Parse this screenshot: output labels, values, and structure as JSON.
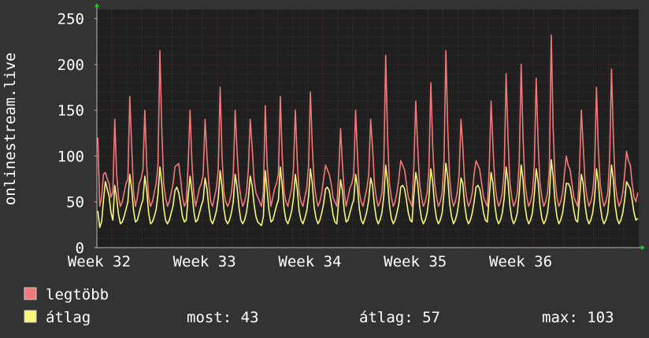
{
  "chart_data": {
    "type": "line",
    "ylabel": "onlinestream.live",
    "ylim": [
      0,
      260
    ],
    "y_ticks": [
      0,
      50,
      100,
      150,
      200,
      250
    ],
    "x_labels": [
      "Week 32",
      "Week 33",
      "Week 34",
      "Week 35",
      "Week 36"
    ],
    "grid": true,
    "legend_position": "bottom-left",
    "samples_per_day": 8,
    "series": [
      {
        "name": "legtöbb",
        "color": "#f27979",
        "values": [
          120,
          45,
          55,
          80,
          82,
          75,
          70,
          55,
          60,
          140,
          80,
          55,
          45,
          50,
          60,
          70,
          75,
          165,
          110,
          60,
          45,
          55,
          70,
          75,
          85,
          150,
          90,
          55,
          45,
          50,
          60,
          70,
          90,
          215,
          130,
          70,
          55,
          45,
          50,
          60,
          70,
          88,
          90,
          92,
          75,
          55,
          45,
          50,
          90,
          150,
          95,
          60,
          45,
          55,
          65,
          70,
          80,
          140,
          100,
          70,
          50,
          45,
          55,
          65,
          85,
          175,
          100,
          60,
          50,
          45,
          50,
          60,
          80,
          150,
          105,
          70,
          55,
          45,
          50,
          60,
          85,
          140,
          110,
          75,
          60,
          55,
          50,
          45,
          60,
          155,
          90,
          65,
          45,
          55,
          65,
          70,
          80,
          165,
          100,
          60,
          50,
          45,
          55,
          65,
          85,
          150,
          95,
          60,
          50,
          45,
          55,
          65,
          90,
          170,
          110,
          70,
          55,
          45,
          50,
          60,
          75,
          90,
          85,
          80,
          70,
          55,
          50,
          45,
          80,
          130,
          90,
          60,
          45,
          55,
          65,
          70,
          80,
          150,
          100,
          60,
          50,
          45,
          55,
          65,
          80,
          140,
          110,
          70,
          55,
          45,
          50,
          60,
          90,
          210,
          120,
          70,
          55,
          45,
          50,
          60,
          75,
          95,
          90,
          85,
          70,
          55,
          50,
          45,
          90,
          160,
          110,
          70,
          55,
          45,
          50,
          60,
          85,
          180,
          110,
          70,
          55,
          45,
          50,
          60,
          95,
          215,
          130,
          75,
          55,
          45,
          50,
          60,
          80,
          140,
          110,
          70,
          55,
          45,
          50,
          60,
          80,
          95,
          90,
          85,
          70,
          55,
          50,
          45,
          85,
          160,
          110,
          70,
          55,
          45,
          50,
          60,
          85,
          190,
          120,
          70,
          55,
          45,
          50,
          60,
          95,
          200,
          120,
          70,
          55,
          45,
          50,
          60,
          90,
          185,
          115,
          70,
          55,
          45,
          50,
          60,
          85,
          232,
          130,
          75,
          55,
          45,
          50,
          60,
          80,
          100,
          90,
          85,
          70,
          55,
          50,
          45,
          85,
          150,
          110,
          70,
          55,
          45,
          50,
          60,
          85,
          175,
          110,
          70,
          55,
          45,
          50,
          60,
          95,
          195,
          120,
          70,
          55,
          45,
          50,
          60,
          80,
          105,
          95,
          90,
          70,
          55,
          50,
          60
        ]
      },
      {
        "name": "átlag",
        "color": "#f7f77a",
        "values": [
          40,
          22,
          28,
          52,
          72,
          64,
          56,
          38,
          30,
          68,
          54,
          36,
          26,
          28,
          34,
          42,
          50,
          80,
          64,
          40,
          28,
          30,
          38,
          46,
          52,
          78,
          62,
          38,
          26,
          28,
          34,
          42,
          58,
          88,
          70,
          44,
          30,
          26,
          30,
          38,
          46,
          62,
          66,
          60,
          48,
          34,
          28,
          30,
          56,
          78,
          62,
          40,
          28,
          30,
          38,
          46,
          52,
          76,
          64,
          44,
          30,
          26,
          32,
          40,
          54,
          84,
          66,
          42,
          30,
          26,
          30,
          38,
          50,
          80,
          66,
          44,
          30,
          26,
          30,
          38,
          54,
          78,
          68,
          48,
          34,
          28,
          26,
          24,
          34,
          84,
          62,
          40,
          28,
          30,
          38,
          46,
          52,
          88,
          68,
          42,
          30,
          26,
          32,
          40,
          54,
          80,
          64,
          40,
          30,
          26,
          32,
          40,
          56,
          86,
          70,
          44,
          32,
          26,
          30,
          38,
          48,
          64,
          66,
          62,
          50,
          36,
          28,
          26,
          50,
          74,
          62,
          40,
          28,
          30,
          38,
          46,
          52,
          80,
          66,
          42,
          30,
          26,
          32,
          40,
          52,
          76,
          68,
          46,
          32,
          26,
          30,
          38,
          56,
          90,
          72,
          46,
          32,
          26,
          30,
          38,
          48,
          66,
          68,
          64,
          52,
          38,
          30,
          28,
          58,
          82,
          70,
          46,
          32,
          26,
          30,
          38,
          54,
          86,
          72,
          46,
          32,
          26,
          30,
          38,
          60,
          92,
          76,
          48,
          34,
          26,
          30,
          38,
          52,
          76,
          70,
          46,
          32,
          26,
          30,
          38,
          50,
          66,
          68,
          64,
          52,
          38,
          30,
          28,
          54,
          82,
          70,
          46,
          32,
          26,
          30,
          38,
          54,
          88,
          72,
          46,
          32,
          26,
          30,
          38,
          60,
          90,
          74,
          46,
          32,
          26,
          30,
          38,
          58,
          86,
          72,
          46,
          32,
          26,
          30,
          38,
          56,
          96,
          78,
          50,
          34,
          26,
          30,
          38,
          52,
          70,
          70,
          66,
          54,
          40,
          30,
          28,
          54,
          80,
          70,
          46,
          32,
          26,
          30,
          38,
          54,
          86,
          72,
          46,
          32,
          26,
          30,
          38,
          60,
          90,
          74,
          46,
          32,
          26,
          30,
          38,
          52,
          72,
          68,
          64,
          52,
          38,
          30,
          32
        ]
      }
    ],
    "legend": [
      {
        "label": "legtöbb",
        "color": "#f27979"
      },
      {
        "label": "átlag",
        "color": "#f7f77a"
      }
    ],
    "stats": {
      "most": "most: 43",
      "atlag": "átlag: 57",
      "max": "max: 103"
    }
  }
}
